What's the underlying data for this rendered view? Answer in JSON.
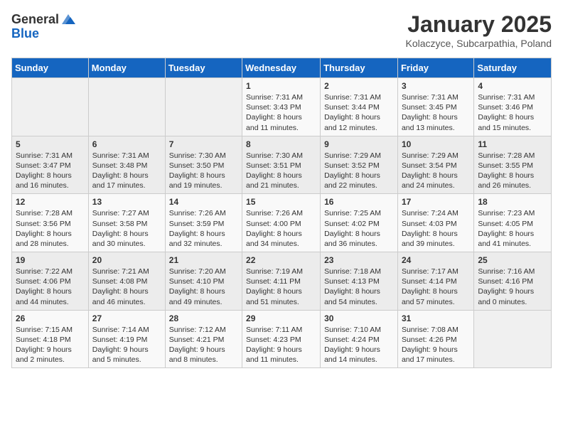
{
  "header": {
    "logo_general": "General",
    "logo_blue": "Blue",
    "title": "January 2025",
    "location": "Kolaczyce, Subcarpathia, Poland"
  },
  "days_of_week": [
    "Sunday",
    "Monday",
    "Tuesday",
    "Wednesday",
    "Thursday",
    "Friday",
    "Saturday"
  ],
  "weeks": [
    [
      {
        "day": "",
        "content": ""
      },
      {
        "day": "",
        "content": ""
      },
      {
        "day": "",
        "content": ""
      },
      {
        "day": "1",
        "content": "Sunrise: 7:31 AM\nSunset: 3:43 PM\nDaylight: 8 hours and 11 minutes."
      },
      {
        "day": "2",
        "content": "Sunrise: 7:31 AM\nSunset: 3:44 PM\nDaylight: 8 hours and 12 minutes."
      },
      {
        "day": "3",
        "content": "Sunrise: 7:31 AM\nSunset: 3:45 PM\nDaylight: 8 hours and 13 minutes."
      },
      {
        "day": "4",
        "content": "Sunrise: 7:31 AM\nSunset: 3:46 PM\nDaylight: 8 hours and 15 minutes."
      }
    ],
    [
      {
        "day": "5",
        "content": "Sunrise: 7:31 AM\nSunset: 3:47 PM\nDaylight: 8 hours and 16 minutes."
      },
      {
        "day": "6",
        "content": "Sunrise: 7:31 AM\nSunset: 3:48 PM\nDaylight: 8 hours and 17 minutes."
      },
      {
        "day": "7",
        "content": "Sunrise: 7:30 AM\nSunset: 3:50 PM\nDaylight: 8 hours and 19 minutes."
      },
      {
        "day": "8",
        "content": "Sunrise: 7:30 AM\nSunset: 3:51 PM\nDaylight: 8 hours and 21 minutes."
      },
      {
        "day": "9",
        "content": "Sunrise: 7:29 AM\nSunset: 3:52 PM\nDaylight: 8 hours and 22 minutes."
      },
      {
        "day": "10",
        "content": "Sunrise: 7:29 AM\nSunset: 3:54 PM\nDaylight: 8 hours and 24 minutes."
      },
      {
        "day": "11",
        "content": "Sunrise: 7:28 AM\nSunset: 3:55 PM\nDaylight: 8 hours and 26 minutes."
      }
    ],
    [
      {
        "day": "12",
        "content": "Sunrise: 7:28 AM\nSunset: 3:56 PM\nDaylight: 8 hours and 28 minutes."
      },
      {
        "day": "13",
        "content": "Sunrise: 7:27 AM\nSunset: 3:58 PM\nDaylight: 8 hours and 30 minutes."
      },
      {
        "day": "14",
        "content": "Sunrise: 7:26 AM\nSunset: 3:59 PM\nDaylight: 8 hours and 32 minutes."
      },
      {
        "day": "15",
        "content": "Sunrise: 7:26 AM\nSunset: 4:00 PM\nDaylight: 8 hours and 34 minutes."
      },
      {
        "day": "16",
        "content": "Sunrise: 7:25 AM\nSunset: 4:02 PM\nDaylight: 8 hours and 36 minutes."
      },
      {
        "day": "17",
        "content": "Sunrise: 7:24 AM\nSunset: 4:03 PM\nDaylight: 8 hours and 39 minutes."
      },
      {
        "day": "18",
        "content": "Sunrise: 7:23 AM\nSunset: 4:05 PM\nDaylight: 8 hours and 41 minutes."
      }
    ],
    [
      {
        "day": "19",
        "content": "Sunrise: 7:22 AM\nSunset: 4:06 PM\nDaylight: 8 hours and 44 minutes."
      },
      {
        "day": "20",
        "content": "Sunrise: 7:21 AM\nSunset: 4:08 PM\nDaylight: 8 hours and 46 minutes."
      },
      {
        "day": "21",
        "content": "Sunrise: 7:20 AM\nSunset: 4:10 PM\nDaylight: 8 hours and 49 minutes."
      },
      {
        "day": "22",
        "content": "Sunrise: 7:19 AM\nSunset: 4:11 PM\nDaylight: 8 hours and 51 minutes."
      },
      {
        "day": "23",
        "content": "Sunrise: 7:18 AM\nSunset: 4:13 PM\nDaylight: 8 hours and 54 minutes."
      },
      {
        "day": "24",
        "content": "Sunrise: 7:17 AM\nSunset: 4:14 PM\nDaylight: 8 hours and 57 minutes."
      },
      {
        "day": "25",
        "content": "Sunrise: 7:16 AM\nSunset: 4:16 PM\nDaylight: 9 hours and 0 minutes."
      }
    ],
    [
      {
        "day": "26",
        "content": "Sunrise: 7:15 AM\nSunset: 4:18 PM\nDaylight: 9 hours and 2 minutes."
      },
      {
        "day": "27",
        "content": "Sunrise: 7:14 AM\nSunset: 4:19 PM\nDaylight: 9 hours and 5 minutes."
      },
      {
        "day": "28",
        "content": "Sunrise: 7:12 AM\nSunset: 4:21 PM\nDaylight: 9 hours and 8 minutes."
      },
      {
        "day": "29",
        "content": "Sunrise: 7:11 AM\nSunset: 4:23 PM\nDaylight: 9 hours and 11 minutes."
      },
      {
        "day": "30",
        "content": "Sunrise: 7:10 AM\nSunset: 4:24 PM\nDaylight: 9 hours and 14 minutes."
      },
      {
        "day": "31",
        "content": "Sunrise: 7:08 AM\nSunset: 4:26 PM\nDaylight: 9 hours and 17 minutes."
      },
      {
        "day": "",
        "content": ""
      }
    ]
  ]
}
